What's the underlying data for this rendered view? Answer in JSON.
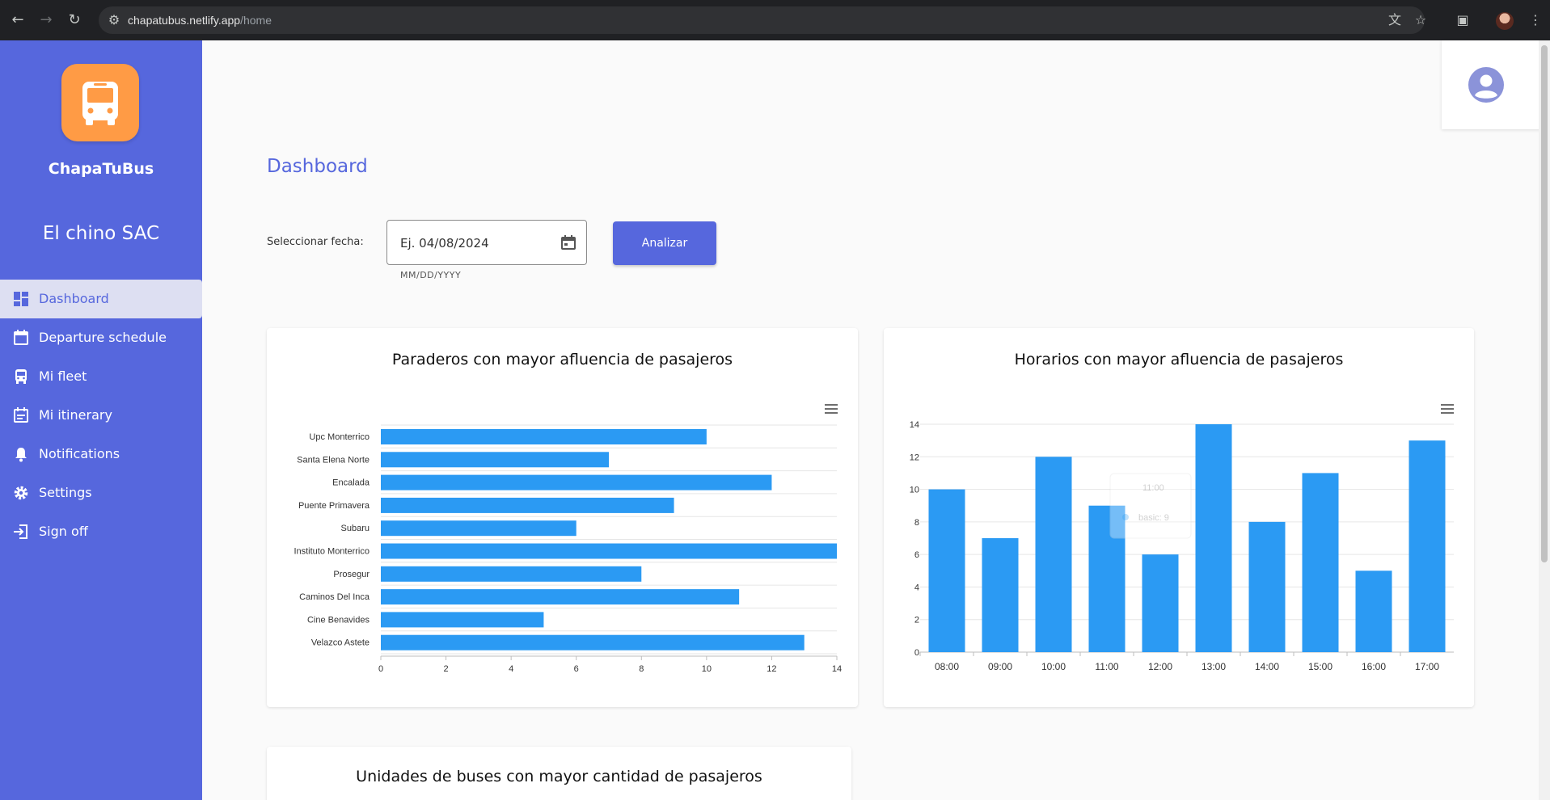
{
  "browser": {
    "url_host": "chapatubus.netlify.app",
    "url_path": "/home"
  },
  "sidebar": {
    "app_name": "ChapaTuBus",
    "company_name": "El chino SAC",
    "items": [
      {
        "label": "Dashboard",
        "icon": "dashboard-icon",
        "active": true
      },
      {
        "label": "Departure schedule",
        "icon": "calendar-icon",
        "active": false
      },
      {
        "label": "Mi fleet",
        "icon": "bus-icon",
        "active": false
      },
      {
        "label": "Mi itinerary",
        "icon": "itinerary-icon",
        "active": false
      },
      {
        "label": "Notifications",
        "icon": "bell-icon",
        "active": false
      },
      {
        "label": "Settings",
        "icon": "gear-icon",
        "active": false
      },
      {
        "label": "Sign off",
        "icon": "logout-icon",
        "active": false
      }
    ]
  },
  "main": {
    "title": "Dashboard",
    "date_label": "Seleccionar fecha:",
    "date_value": "Ej. 04/08/2024",
    "date_hint": "MM/DD/YYYY",
    "analyze_label": "Analizar"
  },
  "colors": {
    "primary": "#5667dd",
    "logo": "#ff9b45",
    "bar": "#2b9af3"
  },
  "chart_data": [
    {
      "type": "bar",
      "orientation": "horizontal",
      "title": "Paraderos con mayor afluencia de pasajeros",
      "categories": [
        "Upc Monterrico",
        "Santa Elena Norte",
        "Encalada",
        "Puente Primavera",
        "Subaru",
        "Instituto Monterrico",
        "Prosegur",
        "Caminos Del Inca",
        "Cine Benavides",
        "Velazco Astete"
      ],
      "values": [
        10,
        7,
        12,
        9,
        6,
        14,
        8,
        11,
        5,
        13
      ],
      "xlim": [
        0,
        14
      ],
      "ticks": [
        "0",
        "2",
        "4",
        "6",
        "8",
        "10",
        "12",
        "14"
      ],
      "grid": true
    },
    {
      "type": "bar",
      "orientation": "vertical",
      "title": "Horarios con mayor afluencia de pasajeros",
      "categories": [
        "08:00",
        "09:00",
        "10:00",
        "11:00",
        "12:00",
        "13:00",
        "14:00",
        "15:00",
        "16:00",
        "17:00"
      ],
      "values": [
        10,
        7,
        12,
        9,
        6,
        14,
        8,
        11,
        5,
        13
      ],
      "ylim": [
        0,
        14
      ],
      "ticks": [
        "0",
        "2",
        "4",
        "6",
        "8",
        "10",
        "12",
        "14"
      ],
      "grid": true,
      "tooltip": {
        "title": "11:00",
        "series": "basic",
        "value": "9"
      }
    }
  ],
  "third_card": {
    "title": "Unidades de buses con mayor cantidad de pasajeros"
  }
}
